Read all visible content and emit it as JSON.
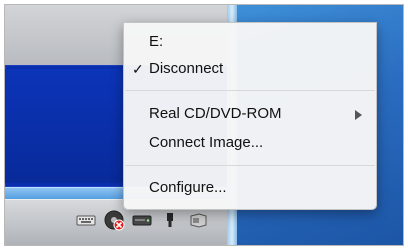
{
  "menu": {
    "items": [
      {
        "label": "E:",
        "checked": false,
        "submenu": false
      },
      {
        "label": "Disconnect",
        "checked": true,
        "submenu": false
      },
      {
        "label": "Real CD/DVD-ROM",
        "checked": false,
        "submenu": true
      },
      {
        "label": "Connect Image...",
        "checked": false,
        "submenu": false
      },
      {
        "label": "Configure...",
        "checked": false,
        "submenu": false
      }
    ],
    "check_glyph": "✓"
  },
  "status_bar": {
    "icons": [
      "keyboard-icon",
      "cd-drive-icon",
      "hard-disk-icon",
      "usb-icon",
      "network-icon"
    ]
  },
  "colors": {
    "menu_background": "#f6f6f6",
    "vm_screen": "#0a2fae",
    "desktop": "#2a6cc0"
  }
}
